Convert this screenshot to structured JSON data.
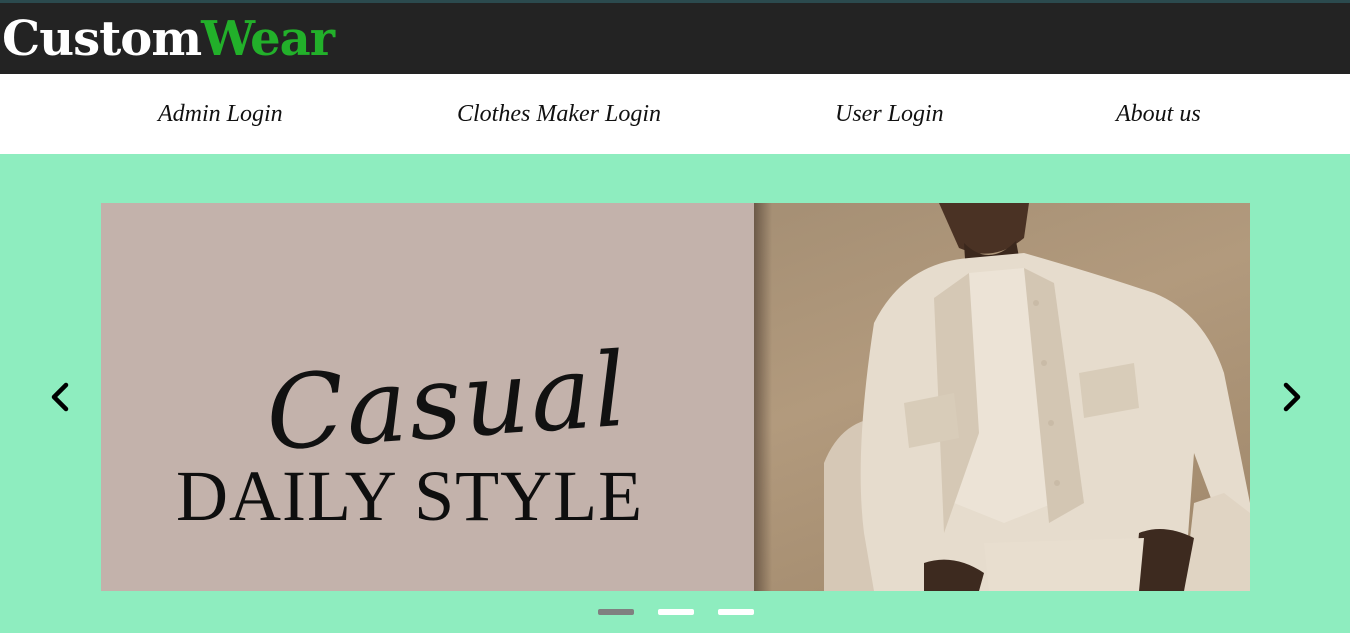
{
  "header": {
    "logo_part1": "Custom",
    "logo_part2": "Wear"
  },
  "nav": {
    "items": [
      {
        "label": "Admin Login"
      },
      {
        "label": "Clothes Maker Login"
      },
      {
        "label": "User Login"
      },
      {
        "label": "About us"
      }
    ]
  },
  "carousel": {
    "slide": {
      "script_text": "Casual",
      "headline": "DAILY STYLE"
    },
    "indicators": [
      {
        "active": true
      },
      {
        "active": false
      },
      {
        "active": false
      }
    ],
    "prev_icon": "chevron-left-icon",
    "next_icon": "chevron-right-icon"
  },
  "colors": {
    "header_bg": "#232323",
    "logo_white": "#ffffff",
    "logo_green": "#22b02a",
    "carousel_bg": "#8eedbf",
    "slide_left_bg": "#c3b2ab",
    "indicator_active": "#808080",
    "indicator_inactive": "#ffffff"
  }
}
